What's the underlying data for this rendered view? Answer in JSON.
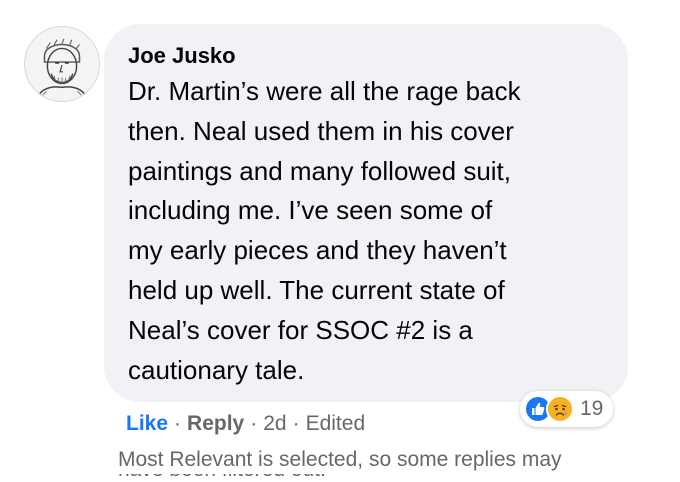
{
  "comment": {
    "author": "Joe Jusko",
    "body_lines": [
      "Dr. Martin’s were all the rage back",
      "then. Neal used them in his cover",
      "paintings and many followed suit,",
      "including me. I’ve seen some of",
      "my early pieces and they haven’t",
      "held up well. The current state of",
      "Neal’s cover for SSOC #2 is a",
      "cautionary tale."
    ],
    "avatar_icon": "sketch-portrait-avatar"
  },
  "reactions": {
    "icons": [
      "like-icon",
      "care-icon"
    ],
    "count": "19",
    "colors": {
      "like": "#1877f2",
      "care": "#f7b125"
    }
  },
  "actions": {
    "like_label": "Like",
    "reply_label": "Reply",
    "time": "2d",
    "edited": "Edited",
    "separator": "·"
  },
  "notice": {
    "text": "Most Relevant is selected, so some replies may",
    "partial_text": "have been filtered out."
  },
  "colors": {
    "bubble": "#f0f2f5",
    "text": "#050505",
    "secondary": "#65676b",
    "link": "#1877f2"
  }
}
